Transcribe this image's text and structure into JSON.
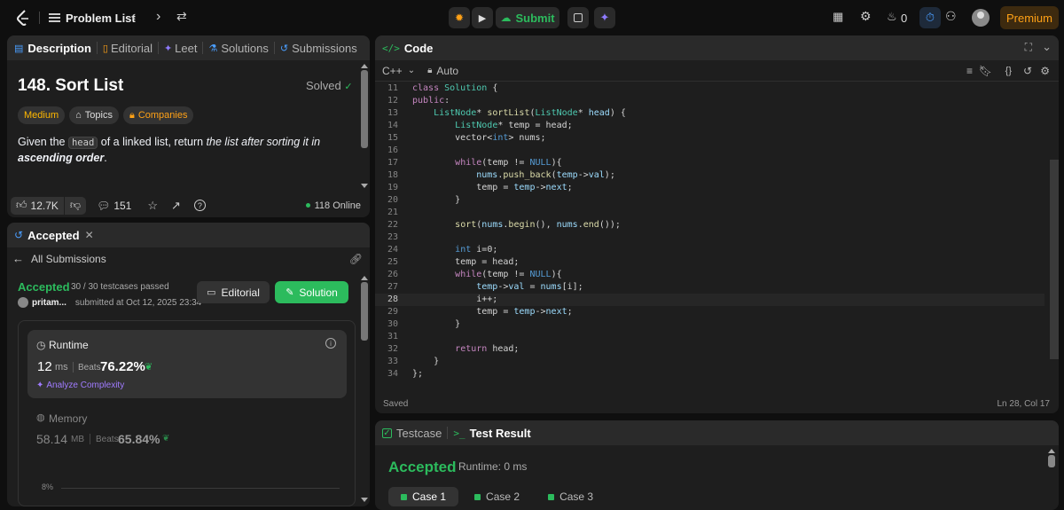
{
  "topbar": {
    "problem_list": "Problem List",
    "submit": "Submit",
    "streak": "0",
    "premium": "Premium"
  },
  "desc_tabs": [
    "Description",
    "Editorial",
    "Leet",
    "Solutions",
    "Submissions"
  ],
  "problem": {
    "title": "148. Sort List",
    "solved": "Solved",
    "difficulty": "Medium",
    "topics": "Topics",
    "companies": "Companies",
    "text_pre": "Given the ",
    "text_code": "head",
    "text_mid": " of a linked list, return ",
    "text_em": "the list after sorting it in ",
    "text_strong": "ascending order",
    "text_end": "."
  },
  "desc_footer": {
    "likes": "12.7K",
    "comments": "151",
    "online": "118 Online"
  },
  "accepted_tab": "Accepted",
  "submission": {
    "all_submissions": "All Submissions",
    "status": "Accepted",
    "testcases": "30 / 30 testcases passed",
    "user": "pritam...",
    "submitted_at": "submitted at Oct 12, 2025 23:34",
    "editorial_btn": "Editorial",
    "solution_btn": "Solution",
    "runtime_label": "Runtime",
    "runtime_value": "12",
    "runtime_unit": "ms",
    "beats_label": "Beats",
    "runtime_beats": "76.22%",
    "analyze": "Analyze Complexity",
    "memory_label": "Memory",
    "memory_value": "58.14",
    "memory_unit": "MB",
    "memory_beats": "65.84%",
    "chart_tick": "8%"
  },
  "code_panel": {
    "title": "Code",
    "language": "C++",
    "mode": "Auto",
    "saved": "Saved",
    "cursor": "Ln 28, Col 17",
    "current_line": 28
  },
  "code_lines": [
    {
      "n": "11",
      "t": [
        [
          "kw",
          "class "
        ],
        [
          "ty",
          "Solution "
        ],
        [
          "tx",
          "{"
        ]
      ]
    },
    {
      "n": "12",
      "t": [
        [
          "kw",
          "public"
        ],
        [
          "tx",
          ":"
        ]
      ]
    },
    {
      "n": "13",
      "t": [
        [
          "tx",
          "    "
        ],
        [
          "ty",
          "ListNode"
        ],
        [
          "tx",
          "* "
        ],
        [
          "fn",
          "sortList"
        ],
        [
          "tx",
          "("
        ],
        [
          "ty",
          "ListNode"
        ],
        [
          "tx",
          "* "
        ],
        [
          "vr",
          "head"
        ],
        [
          "tx",
          ") {"
        ]
      ]
    },
    {
      "n": "14",
      "t": [
        [
          "tx",
          "        "
        ],
        [
          "ty",
          "ListNode"
        ],
        [
          "tx",
          "* temp = head;"
        ]
      ]
    },
    {
      "n": "15",
      "t": [
        [
          "tx",
          "        vector<"
        ],
        [
          "bl",
          "int"
        ],
        [
          "tx",
          "> nums;"
        ]
      ]
    },
    {
      "n": "16",
      "t": [
        [
          "tx",
          ""
        ]
      ]
    },
    {
      "n": "17",
      "t": [
        [
          "tx",
          "        "
        ],
        [
          "kw",
          "while"
        ],
        [
          "tx",
          "(temp != "
        ],
        [
          "bl",
          "NULL"
        ],
        [
          "tx",
          "){"
        ]
      ]
    },
    {
      "n": "18",
      "t": [
        [
          "tx",
          "            "
        ],
        [
          "vr",
          "nums"
        ],
        [
          "tx",
          "."
        ],
        [
          "fn",
          "push_back"
        ],
        [
          "tx",
          "("
        ],
        [
          "vr",
          "temp"
        ],
        [
          "tx",
          "->"
        ],
        [
          "vr",
          "val"
        ],
        [
          "tx",
          ");"
        ]
      ]
    },
    {
      "n": "19",
      "t": [
        [
          "tx",
          "            temp = "
        ],
        [
          "vr",
          "temp"
        ],
        [
          "tx",
          "->"
        ],
        [
          "vr",
          "next"
        ],
        [
          "tx",
          ";"
        ]
      ]
    },
    {
      "n": "20",
      "t": [
        [
          "tx",
          "        }"
        ]
      ]
    },
    {
      "n": "21",
      "t": [
        [
          "tx",
          ""
        ]
      ]
    },
    {
      "n": "22",
      "t": [
        [
          "tx",
          "        "
        ],
        [
          "fn",
          "sort"
        ],
        [
          "tx",
          "("
        ],
        [
          "vr",
          "nums"
        ],
        [
          "tx",
          "."
        ],
        [
          "fn",
          "begin"
        ],
        [
          "tx",
          "(), "
        ],
        [
          "vr",
          "nums"
        ],
        [
          "tx",
          "."
        ],
        [
          "fn",
          "end"
        ],
        [
          "tx",
          "());"
        ]
      ]
    },
    {
      "n": "23",
      "t": [
        [
          "tx",
          ""
        ]
      ]
    },
    {
      "n": "24",
      "t": [
        [
          "tx",
          "        "
        ],
        [
          "bl",
          "int "
        ],
        [
          "tx",
          "i="
        ],
        [
          "tx",
          "0;"
        ]
      ]
    },
    {
      "n": "25",
      "t": [
        [
          "tx",
          "        temp = head;"
        ]
      ]
    },
    {
      "n": "26",
      "t": [
        [
          "tx",
          "        "
        ],
        [
          "kw",
          "while"
        ],
        [
          "tx",
          "(temp != "
        ],
        [
          "bl",
          "NULL"
        ],
        [
          "tx",
          "){"
        ]
      ]
    },
    {
      "n": "27",
      "t": [
        [
          "tx",
          "            "
        ],
        [
          "vr",
          "temp"
        ],
        [
          "tx",
          "->"
        ],
        [
          "vr",
          "val"
        ],
        [
          "tx",
          " = "
        ],
        [
          "vr",
          "nums"
        ],
        [
          "tx",
          "[i];"
        ]
      ]
    },
    {
      "n": "28",
      "t": [
        [
          "tx",
          "            i++;"
        ]
      ]
    },
    {
      "n": "29",
      "t": [
        [
          "tx",
          "            temp = "
        ],
        [
          "vr",
          "temp"
        ],
        [
          "tx",
          "->"
        ],
        [
          "vr",
          "next"
        ],
        [
          "tx",
          ";"
        ]
      ]
    },
    {
      "n": "30",
      "t": [
        [
          "tx",
          "        }"
        ]
      ]
    },
    {
      "n": "31",
      "t": [
        [
          "tx",
          ""
        ]
      ]
    },
    {
      "n": "32",
      "t": [
        [
          "tx",
          "        "
        ],
        [
          "kw",
          "return "
        ],
        [
          "tx",
          "head;"
        ]
      ]
    },
    {
      "n": "33",
      "t": [
        [
          "tx",
          "    }"
        ]
      ]
    },
    {
      "n": "34",
      "t": [
        [
          "tx",
          "};"
        ]
      ]
    }
  ],
  "result_panel": {
    "testcase_tab": "Testcase",
    "result_tab": "Test Result",
    "status": "Accepted",
    "runtime": "Runtime: 0 ms",
    "cases": [
      "Case 1",
      "Case 2",
      "Case 3"
    ]
  },
  "colors": {
    "accent_green": "#2cbb5d",
    "orange": "#ffa116",
    "medium": "#ffb800",
    "premium_bg": "#3d2a0f"
  }
}
